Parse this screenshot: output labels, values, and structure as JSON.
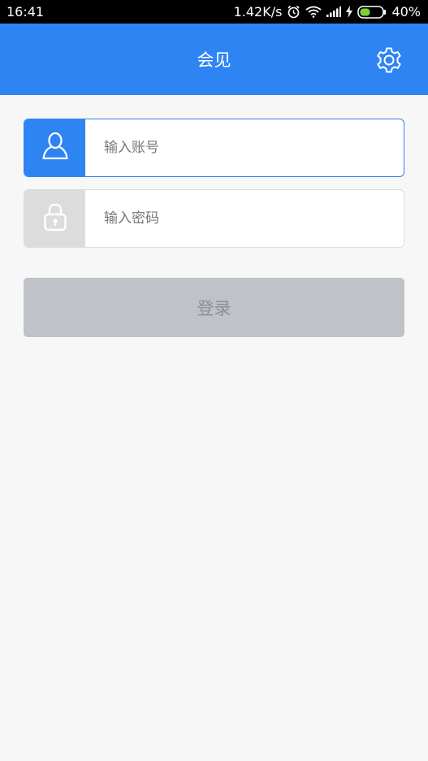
{
  "status_bar": {
    "time": "16:41",
    "network_speed": "1.42K/s",
    "battery_percent": "40%",
    "icons": [
      "alarm-icon",
      "wifi-icon",
      "signal-icon",
      "charging-icon",
      "battery-icon"
    ]
  },
  "app_bar": {
    "title": "会见",
    "settings_icon": "gear-icon"
  },
  "form": {
    "account": {
      "placeholder": "输入账号",
      "value": "",
      "icon": "user-icon"
    },
    "password": {
      "placeholder": "输入密码",
      "value": "",
      "icon": "lock-icon"
    },
    "login_label": "登录"
  },
  "colors": {
    "brand": "#2f84f3",
    "background": "#f7f7f7",
    "button_disabled": "#bfc2c6",
    "button_text_disabled": "#8c8f93",
    "inactive_icon_box": "#dcdcdc"
  }
}
